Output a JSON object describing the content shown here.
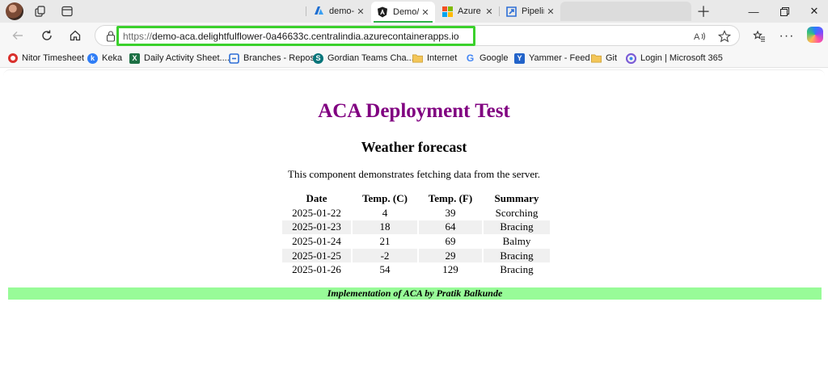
{
  "tabs": [
    {
      "title": "demo-",
      "favicon": "azure-icon",
      "active": false
    },
    {
      "title": "Demo/",
      "favicon": "angular-icon",
      "active": true
    },
    {
      "title": "Azure",
      "favicon": "microsoft-icon",
      "active": false
    },
    {
      "title": "Pipelin",
      "favicon": "azure-pipelines-icon",
      "active": false
    }
  ],
  "address_bar": {
    "scheme": "https://",
    "url": "demo-aca.delightfulflower-0a46633c.centralindia.azurecontainerapps.io"
  },
  "favorites": [
    {
      "label": "Nitor Timesheet",
      "icon": "nitor-icon",
      "color": "#d9302c"
    },
    {
      "label": "Keka",
      "icon": "keka-icon",
      "color": "#2f7df6"
    },
    {
      "label": "Daily Activity Sheet....",
      "icon": "excel-icon",
      "color": "#1d7044"
    },
    {
      "label": "Branches - Repos",
      "icon": "azure-repos-icon",
      "color": "#2e6fd6"
    },
    {
      "label": "Gordian Teams Cha...",
      "icon": "sharepoint-icon",
      "color": "#08757a"
    },
    {
      "label": "Internet",
      "icon": "folder-icon",
      "color": "#e8b84a"
    },
    {
      "label": "Google",
      "icon": "google-icon",
      "color": "#4285f4"
    },
    {
      "label": "Yammer - Feed",
      "icon": "yammer-icon",
      "color": "#2263c9"
    },
    {
      "label": "Git",
      "icon": "folder-icon",
      "color": "#e8b84a"
    },
    {
      "label": "Login | Microsoft 365",
      "icon": "microsoft365-icon",
      "color": "#7b5cd6"
    }
  ],
  "page": {
    "heading": "ACA Deployment Test",
    "subheading": "Weather forecast",
    "description": "This component demonstrates fetching data from the server.",
    "table": {
      "headers": [
        "Date",
        "Temp. (C)",
        "Temp. (F)",
        "Summary"
      ],
      "rows": [
        [
          "2025-01-22",
          "4",
          "39",
          "Scorching"
        ],
        [
          "2025-01-23",
          "18",
          "64",
          "Bracing"
        ],
        [
          "2025-01-24",
          "21",
          "69",
          "Balmy"
        ],
        [
          "2025-01-25",
          "-2",
          "29",
          "Bracing"
        ],
        [
          "2025-01-26",
          "54",
          "129",
          "Bracing"
        ]
      ]
    },
    "footer": "Implementation of ACA by Pratik Balkunde"
  },
  "colors": {
    "heading": "#800080",
    "footer_bg": "#98fb98",
    "url_highlight": "#3bd12c",
    "active_tab_indicator": "#2fb24a"
  }
}
